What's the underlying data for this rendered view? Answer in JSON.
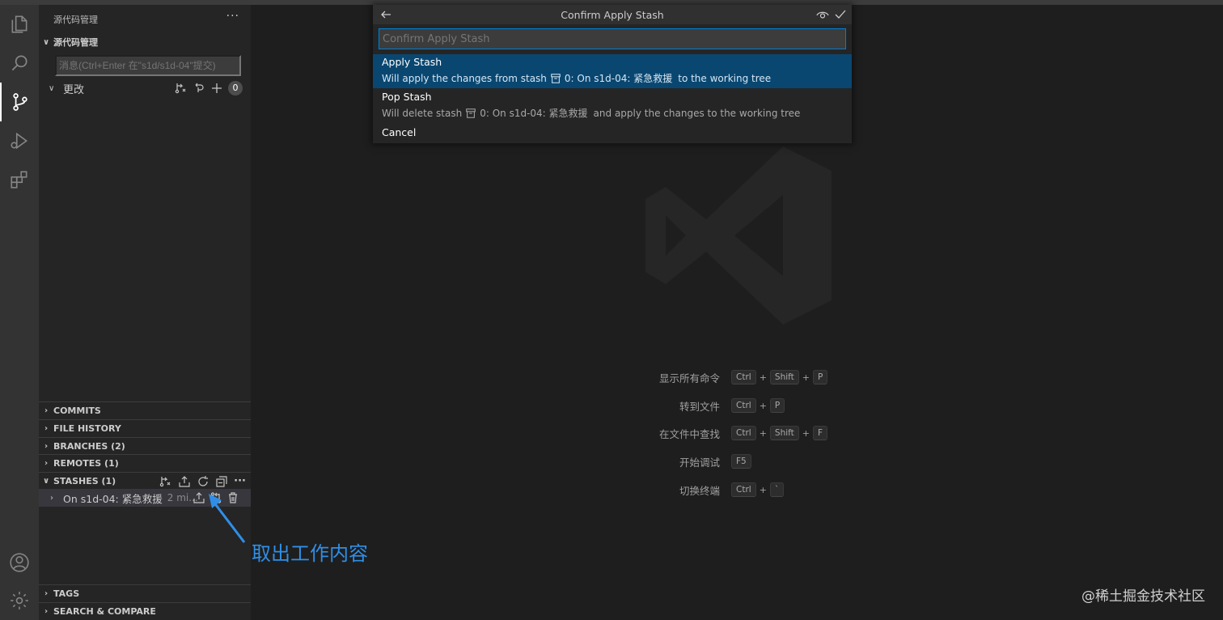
{
  "sidebar": {
    "title": "源代码管理",
    "more_label": "···",
    "scm_section_title": "源代码管理",
    "commit_placeholder": "消息(Ctrl+Enter 在\"s1d/s1d-04\"提交)",
    "changes_label": "更改",
    "changes_count": "0",
    "sections": {
      "commits": "COMMITS",
      "file_history": "FILE HISTORY",
      "branches": "BRANCHES (2)",
      "remotes": "REMOTES (1)",
      "stashes": "STASHES (1)",
      "tags": "TAGS",
      "search_compare": "SEARCH & COMPARE"
    },
    "stashes_more_label": "···",
    "stash_item": {
      "label": "On s1d-04: 紧急救援",
      "time": "2 mi..."
    }
  },
  "quickpick": {
    "title": "Confirm Apply Stash",
    "placeholder": "Confirm Apply Stash",
    "items": [
      {
        "label": "Apply Stash",
        "desc_prefix": "Will apply the changes from stash",
        "desc_stash": "0: On s1d-04: 紧急救援",
        "desc_suffix": "to the working tree"
      },
      {
        "label": "Pop Stash",
        "desc_prefix": "Will delete stash",
        "desc_stash": "0: On s1d-04: 紧急救援",
        "desc_suffix": "and apply the changes to the working tree"
      },
      {
        "label": "Cancel"
      }
    ]
  },
  "editor": {
    "shortcuts": [
      {
        "label": "显示所有命令",
        "keys": [
          "Ctrl",
          "Shift",
          "P"
        ]
      },
      {
        "label": "转到文件",
        "keys": [
          "Ctrl",
          "P"
        ]
      },
      {
        "label": "在文件中查找",
        "keys": [
          "Ctrl",
          "Shift",
          "F"
        ]
      },
      {
        "label": "开始调试",
        "keys": [
          "F5"
        ]
      },
      {
        "label": "切换终端",
        "keys": [
          "Ctrl",
          "`"
        ]
      }
    ],
    "plus": "+"
  },
  "annotation": {
    "text": "取出工作内容"
  },
  "site_watermark": "@稀土掘金技术社区",
  "colors": {
    "accent": "#007fd4",
    "selection": "#094771",
    "annotation": "#2f8fe8",
    "activity_bar": "#333333",
    "sidebar": "#252526",
    "editor": "#1e1e1e"
  }
}
